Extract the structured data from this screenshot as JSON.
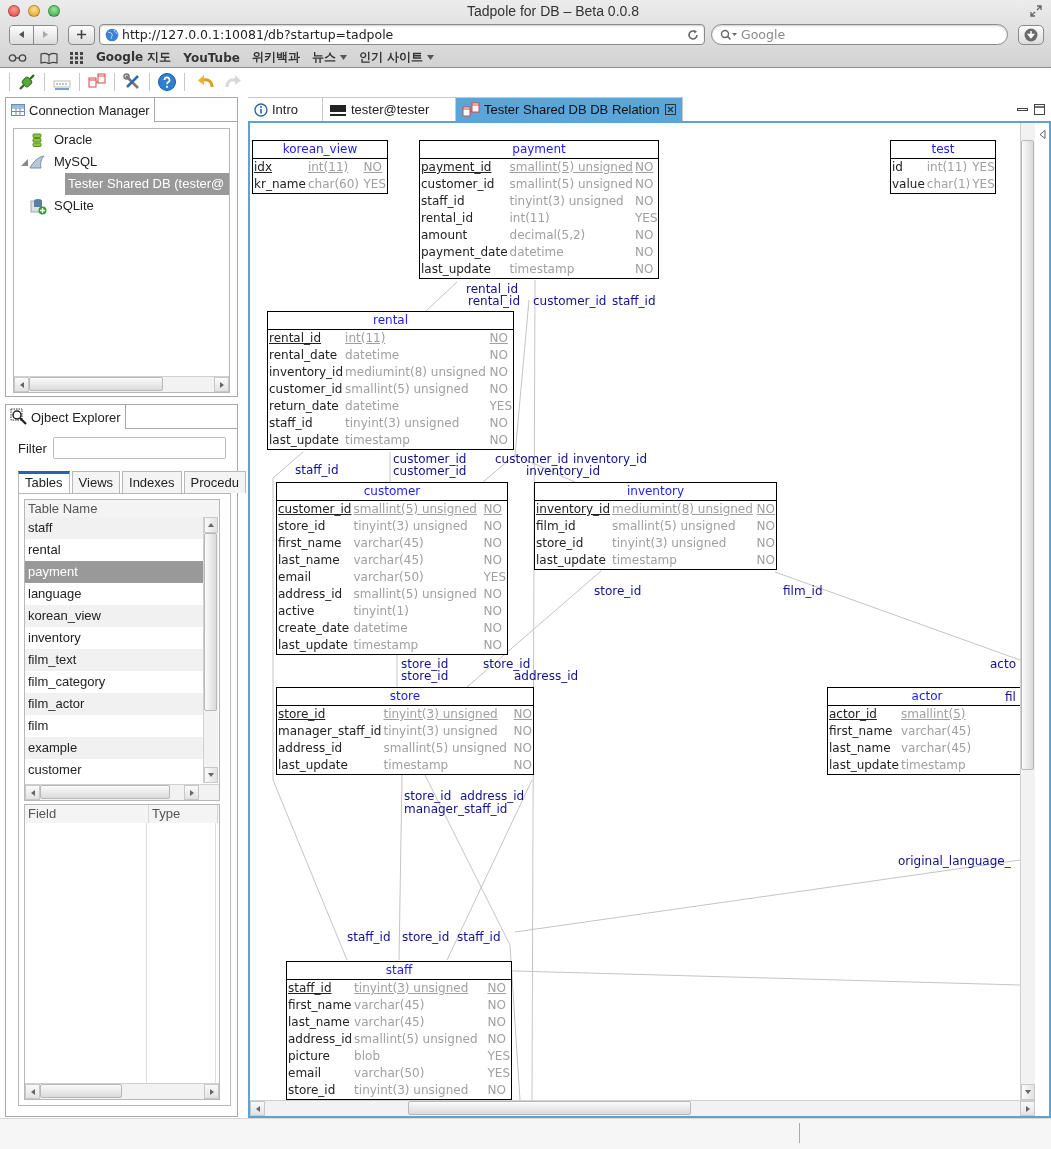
{
  "window": {
    "title": "Tadpole for DB – Beta 0.0.8"
  },
  "browser": {
    "url": "http://127.0.0.1:10081/db?startup=tadpole",
    "search": {
      "placeholder": "Google"
    },
    "bookmarks": [
      {
        "label": "Google 지도"
      },
      {
        "label": "YouTube"
      },
      {
        "label": "위키백과"
      },
      {
        "label": "뉴스",
        "menu": true
      },
      {
        "label": "인기 사이트",
        "menu": true
      }
    ]
  },
  "connection_manager": {
    "title": "Connection Manager",
    "tree": [
      {
        "label": "Oracle",
        "kind": "oracle",
        "selected": false
      },
      {
        "label": "MySQL",
        "kind": "mysql",
        "selected": false,
        "expanded": true,
        "children": [
          {
            "label": "Tester Shared DB (tester@",
            "selected": true
          }
        ]
      },
      {
        "label": "SQLite",
        "kind": "sqlite",
        "selected": false
      }
    ]
  },
  "object_explorer": {
    "title": "Ojbect Explorer",
    "filter": {
      "label": "Filter"
    },
    "tabs": [
      {
        "label": "Tables",
        "selected": true
      },
      {
        "label": "Views",
        "selected": false
      },
      {
        "label": "Indexes",
        "selected": false
      },
      {
        "label": "Procedu",
        "selected": false
      }
    ],
    "table_list": {
      "header": "Table Name",
      "rows": [
        {
          "name": "staff",
          "selected": false
        },
        {
          "name": "rental",
          "selected": false
        },
        {
          "name": "payment",
          "selected": true
        },
        {
          "name": "language",
          "selected": false
        },
        {
          "name": "korean_view",
          "selected": false
        },
        {
          "name": "inventory",
          "selected": false
        },
        {
          "name": "film_text",
          "selected": false
        },
        {
          "name": "film_category",
          "selected": false
        },
        {
          "name": "film_actor",
          "selected": false
        },
        {
          "name": "film",
          "selected": false
        },
        {
          "name": "example",
          "selected": false
        },
        {
          "name": "customer",
          "selected": false
        }
      ]
    },
    "field_list": {
      "columns": [
        "Field",
        "Type"
      ]
    }
  },
  "editor_tabs": [
    {
      "label": "Intro",
      "kind": "info",
      "selected": false
    },
    {
      "label": "tester@tester",
      "kind": "sql",
      "selected": false
    },
    {
      "label": "Tester Shared DB DB Relation",
      "kind": "relation",
      "selected": true,
      "closable": true
    }
  ],
  "diagram": {
    "tables": [
      {
        "name": "korean_view",
        "columns": [
          {
            "name": "idx",
            "type": "int(11)",
            "null": "NO",
            "primary": true
          },
          {
            "name": "kr_name",
            "type": "char(60)",
            "null": "YES",
            "primary": false
          }
        ]
      },
      {
        "name": "payment",
        "columns": [
          {
            "name": "payment_id",
            "type": "smallint(5) unsigned",
            "null": "NO",
            "primary": true
          },
          {
            "name": "customer_id",
            "type": "smallint(5) unsigned",
            "null": "NO",
            "primary": false
          },
          {
            "name": "staff_id",
            "type": "tinyint(3) unsigned",
            "null": "NO",
            "primary": false
          },
          {
            "name": "rental_id",
            "type": "int(11)",
            "null": "YES",
            "primary": false
          },
          {
            "name": "amount",
            "type": "decimal(5,2)",
            "null": "NO",
            "primary": false
          },
          {
            "name": "payment_date",
            "type": "datetime",
            "null": "NO",
            "primary": false
          },
          {
            "name": "last_update",
            "type": "timestamp",
            "null": "NO",
            "primary": false
          }
        ]
      },
      {
        "name": "test",
        "columns": [
          {
            "name": "id",
            "type": "int(11)",
            "null": "YES",
            "primary": false
          },
          {
            "name": "value",
            "type": "char(1)",
            "null": "YES",
            "primary": false
          }
        ]
      },
      {
        "name": "rental",
        "columns": [
          {
            "name": "rental_id",
            "type": "int(11)",
            "null": "NO",
            "primary": true
          },
          {
            "name": "rental_date",
            "type": "datetime",
            "null": "NO",
            "primary": false
          },
          {
            "name": "inventory_id",
            "type": "mediumint(8) unsigned",
            "null": "NO",
            "primary": false
          },
          {
            "name": "customer_id",
            "type": "smallint(5) unsigned",
            "null": "NO",
            "primary": false
          },
          {
            "name": "return_date",
            "type": "datetime",
            "null": "YES",
            "primary": false
          },
          {
            "name": "staff_id",
            "type": "tinyint(3) unsigned",
            "null": "NO",
            "primary": false
          },
          {
            "name": "last_update",
            "type": "timestamp",
            "null": "NO",
            "primary": false
          }
        ]
      },
      {
        "name": "customer",
        "columns": [
          {
            "name": "customer_id",
            "type": "smallint(5) unsigned",
            "null": "NO",
            "primary": true
          },
          {
            "name": "store_id",
            "type": "tinyint(3) unsigned",
            "null": "NO",
            "primary": false
          },
          {
            "name": "first_name",
            "type": "varchar(45)",
            "null": "NO",
            "primary": false
          },
          {
            "name": "last_name",
            "type": "varchar(45)",
            "null": "NO",
            "primary": false
          },
          {
            "name": "email",
            "type": "varchar(50)",
            "null": "YES",
            "primary": false
          },
          {
            "name": "address_id",
            "type": "smallint(5) unsigned",
            "null": "NO",
            "primary": false
          },
          {
            "name": "active",
            "type": "tinyint(1)",
            "null": "NO",
            "primary": false
          },
          {
            "name": "create_date",
            "type": "datetime",
            "null": "NO",
            "primary": false
          },
          {
            "name": "last_update",
            "type": "timestamp",
            "null": "NO",
            "primary": false
          }
        ]
      },
      {
        "name": "inventory",
        "columns": [
          {
            "name": "inventory_id",
            "type": "mediumint(8) unsigned",
            "null": "NO",
            "primary": true
          },
          {
            "name": "film_id",
            "type": "smallint(5) unsigned",
            "null": "NO",
            "primary": false
          },
          {
            "name": "store_id",
            "type": "tinyint(3) unsigned",
            "null": "NO",
            "primary": false
          },
          {
            "name": "last_update",
            "type": "timestamp",
            "null": "NO",
            "primary": false
          }
        ]
      },
      {
        "name": "store",
        "columns": [
          {
            "name": "store_id",
            "type": "tinyint(3) unsigned",
            "null": "NO",
            "primary": true
          },
          {
            "name": "manager_staff_id",
            "type": "tinyint(3) unsigned",
            "null": "NO",
            "primary": false
          },
          {
            "name": "address_id",
            "type": "smallint(5) unsigned",
            "null": "NO",
            "primary": false
          },
          {
            "name": "last_update",
            "type": "timestamp",
            "null": "NO",
            "primary": false
          }
        ]
      },
      {
        "name": "actor",
        "columns": [
          {
            "name": "actor_id",
            "type": "smallint(5)",
            "primary": true
          },
          {
            "name": "first_name",
            "type": "varchar(45)",
            "primary": false
          },
          {
            "name": "last_name",
            "type": "varchar(45)",
            "primary": false
          },
          {
            "name": "last_update",
            "type": "timestamp",
            "primary": false
          }
        ]
      },
      {
        "name": "staff",
        "columns": [
          {
            "name": "staff_id",
            "type": "tinyint(3) unsigned",
            "null": "NO",
            "primary": true
          },
          {
            "name": "first_name",
            "type": "varchar(45)",
            "null": "NO",
            "primary": false
          },
          {
            "name": "last_name",
            "type": "varchar(45)",
            "null": "NO",
            "primary": false
          },
          {
            "name": "address_id",
            "type": "smallint(5) unsigned",
            "null": "NO",
            "primary": false
          },
          {
            "name": "picture",
            "type": "blob",
            "null": "YES",
            "primary": false
          },
          {
            "name": "email",
            "type": "varchar(50)",
            "null": "YES",
            "primary": false
          },
          {
            "name": "store_id",
            "type": "tinyint(3) unsigned",
            "null": "NO",
            "primary": false
          }
        ]
      }
    ],
    "relation_labels": [
      "rental_id",
      "rental_id",
      "customer_id",
      "staff_id",
      "customer_id",
      "customer_id",
      "inventory_id",
      "staff_id",
      "customer_id",
      "inventory_id",
      "store_id",
      "film_id",
      "store_id",
      "store_id",
      "acto",
      "store_id",
      "address_id",
      "fil",
      "store_id",
      "address_id",
      "manager_staff_id",
      "original_language_",
      "staff_id",
      "store_id",
      "staff_id"
    ]
  }
}
